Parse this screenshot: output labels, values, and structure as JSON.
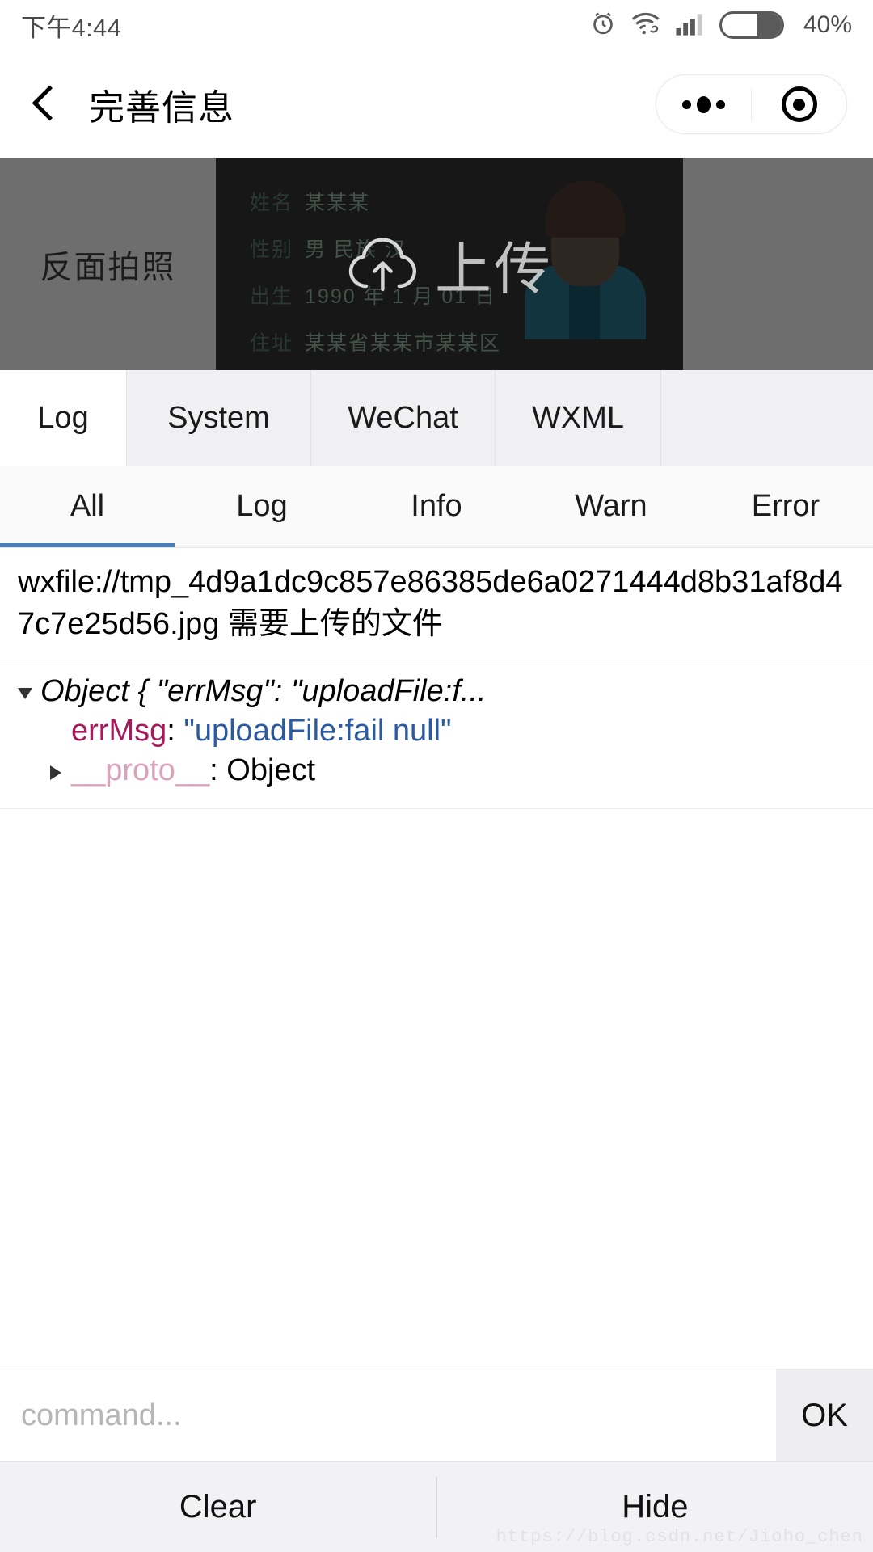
{
  "statusbar": {
    "time": "下午4:44",
    "battery_percent": "40%",
    "icons": [
      "alarm-icon",
      "wifi-icon",
      "signal-icon",
      "battery-icon"
    ]
  },
  "navbar": {
    "back_label": "back-icon",
    "title": "完善信息",
    "capsule": {
      "menu_label": "more-icon",
      "target_label": "target-icon"
    }
  },
  "photo_area": {
    "left_label": "反面拍照",
    "upload_label": "上传",
    "idcard": {
      "rows": [
        {
          "label": "姓名",
          "value": "某某某"
        },
        {
          "label": "性别",
          "value": "男    民族  汉"
        },
        {
          "label": "出生",
          "value": "1990 年 1 月 01 日"
        },
        {
          "label": "住址",
          "value": "某某省某某市某某区"
        }
      ]
    }
  },
  "console": {
    "tabs": [
      {
        "label": "Log",
        "active": true
      },
      {
        "label": "System",
        "active": false
      },
      {
        "label": "WeChat",
        "active": false
      },
      {
        "label": "WXML",
        "active": false
      }
    ],
    "filters": [
      {
        "label": "All",
        "active": true
      },
      {
        "label": "Log",
        "active": false
      },
      {
        "label": "Info",
        "active": false
      },
      {
        "label": "Warn",
        "active": false
      },
      {
        "label": "Error",
        "active": false
      }
    ],
    "log_entry": {
      "path": "wxfile://tmp_4d9a1dc9c857e86385de6a0271444d8b31af8d47c7e25d56.jpg",
      "note": "需要上传的文件"
    },
    "error_object": {
      "summary": "Object { \"errMsg\": \"uploadFile:f...",
      "key": "errMsg",
      "separator": ": ",
      "value": "\"uploadFile:fail null\"",
      "proto_key": "__proto__",
      "proto_sep": ": ",
      "proto_value": "Object"
    },
    "command": {
      "placeholder": "command...",
      "value": "",
      "ok_label": "OK"
    },
    "buttons": {
      "clear_label": "Clear",
      "hide_label": "Hide"
    }
  },
  "watermark": "https://blog.csdn.net/Jioho_chen",
  "colors": {
    "accent": "#4a7ebb",
    "key": "#a61b5c",
    "string": "#2c5aa0",
    "proto": "#d9a3bb",
    "tab_bg": "#f0f0f2"
  }
}
